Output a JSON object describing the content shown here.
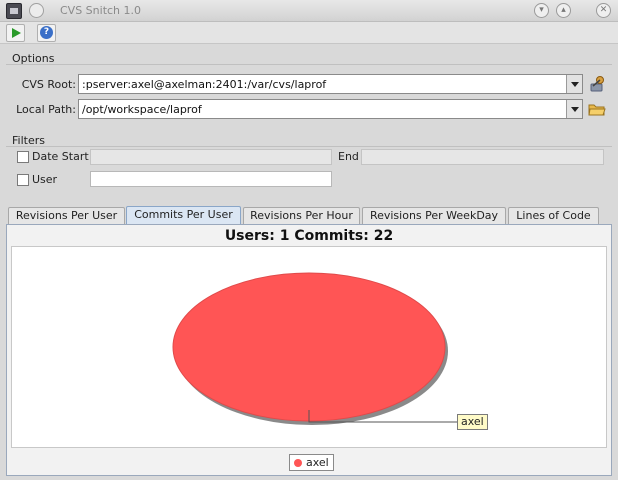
{
  "window": {
    "title": "CVS Snitch 1.0"
  },
  "toolbar": {
    "run_icon": "play-icon",
    "help_icon": "help-icon",
    "help_glyph": "?"
  },
  "options": {
    "title": "Options",
    "cvs_root_label": "CVS Root:",
    "cvs_root_value": ":pserver:axel@axelman:2401:/var/cvs/laprof",
    "local_path_label": "Local Path:",
    "local_path_value": "/opt/workspace/laprof"
  },
  "filters": {
    "title": "Filters",
    "date_start_label": "Date Start",
    "end_label": "End",
    "user_label": "User",
    "date_start_value": "",
    "end_value": "",
    "user_value": ""
  },
  "tabs": [
    {
      "label": "Revisions Per User",
      "active": false
    },
    {
      "label": "Commits Per User",
      "active": true
    },
    {
      "label": "Revisions Per Hour",
      "active": false
    },
    {
      "label": "Revisions Per WeekDay",
      "active": false
    },
    {
      "label": "Lines of Code",
      "active": false
    }
  ],
  "chart_data": {
    "type": "pie",
    "title": "Users: 1 Commits: 22",
    "slices": [
      {
        "label": "axel",
        "value": 22,
        "color": "#ff5555"
      }
    ],
    "legend": [
      "axel"
    ],
    "legend_position": "bottom"
  }
}
